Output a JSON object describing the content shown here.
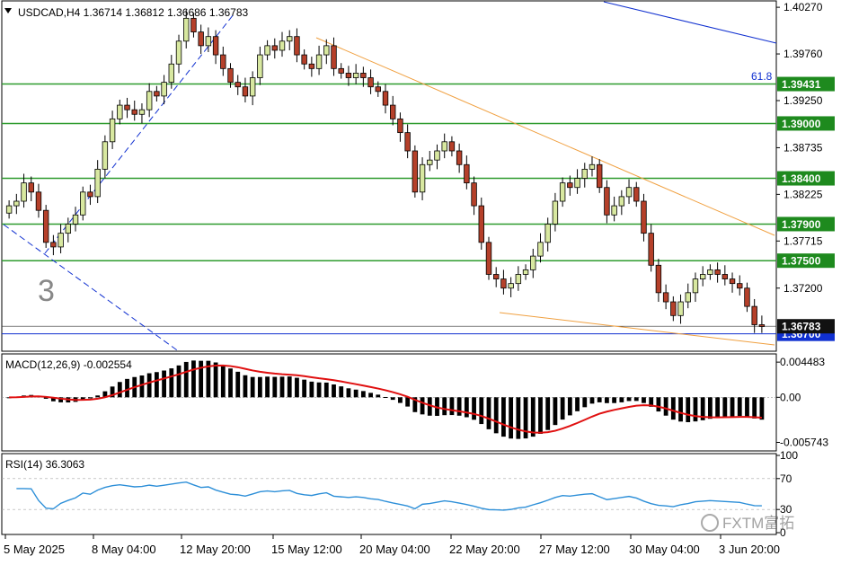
{
  "header": {
    "symbol_line": "USDCAD,H4  1.36714  1.36812  1.36686  1.36783"
  },
  "wave_label": "3",
  "fib_label": "61.8",
  "watermark": "FXTM富拓",
  "current_price_label": "1.36783",
  "blue_line_label": "1.36700",
  "colors": {
    "bull_candle": "#d8e8a0",
    "bear_candle": "#b5402a",
    "support_line": "#2e9b2e",
    "support_label_bg": "#1e8a1e",
    "blue_line": "#1030d0",
    "orange_line": "#f0a040",
    "macd_hist": "#000000",
    "macd_signal": "#e01010",
    "rsi_line": "#2d8fd8"
  },
  "chart_data": [
    {
      "type": "candlestick",
      "title": "USDCAD,H4",
      "ohlc_header": {
        "open": 1.36714,
        "high": 1.36812,
        "low": 1.36686,
        "close": 1.36783
      },
      "y_axis_ticks": [
        "1.40270",
        "1.39760",
        "1.39250",
        "1.38735",
        "1.38225",
        "1.37715",
        "1.37200"
      ],
      "y_range": [
        1.3652,
        1.4033
      ],
      "x_axis_ticks": [
        "5 May 2025",
        "8 May 04:00",
        "12 May 20:00",
        "15 May 12:00",
        "20 May 04:00",
        "22 May 20:00",
        "27 May 12:00",
        "30 May 04:00",
        "3 Jun 20:00"
      ],
      "horizontal_levels": [
        {
          "value": 1.39431,
          "label": "1.39431",
          "color": "green"
        },
        {
          "value": 1.39,
          "label": "1.39000",
          "color": "green"
        },
        {
          "value": 1.384,
          "label": "1.38400",
          "color": "green"
        },
        {
          "value": 1.379,
          "label": "1.37900",
          "color": "green"
        },
        {
          "value": 1.375,
          "label": "1.37500",
          "color": "green"
        },
        {
          "value": 1.367,
          "label": "1.36700",
          "color": "blue"
        }
      ],
      "current_price": 1.36783,
      "closes": [
        1.381,
        1.3815,
        1.3835,
        1.3825,
        1.3805,
        1.377,
        1.3765,
        1.378,
        1.379,
        1.38,
        1.3825,
        1.382,
        1.385,
        1.388,
        1.3905,
        1.392,
        1.3915,
        1.391,
        1.3915,
        1.3935,
        1.393,
        1.3945,
        1.3965,
        1.399,
        1.4015,
        1.4,
        1.3985,
        1.3995,
        1.3975,
        1.396,
        1.3945,
        1.394,
        1.393,
        1.395,
        1.3975,
        1.3985,
        1.398,
        1.399,
        1.3995,
        1.3975,
        1.3965,
        1.396,
        1.3975,
        1.3985,
        1.396,
        1.3955,
        1.395,
        1.3955,
        1.395,
        1.394,
        1.3935,
        1.392,
        1.3905,
        1.389,
        1.387,
        1.3825,
        1.3855,
        1.386,
        1.387,
        1.388,
        1.387,
        1.3855,
        1.3835,
        1.381,
        1.377,
        1.3735,
        1.373,
        1.372,
        1.3725,
        1.3735,
        1.374,
        1.3755,
        1.377,
        1.379,
        1.3815,
        1.3835,
        1.383,
        1.384,
        1.385,
        1.3855,
        1.383,
        1.38,
        1.381,
        1.382,
        1.383,
        1.3815,
        1.378,
        1.3745,
        1.3715,
        1.3705,
        1.369,
        1.3705,
        1.3715,
        1.373,
        1.3735,
        1.374,
        1.3735,
        1.373,
        1.3725,
        1.372,
        1.37,
        1.368,
        1.3678
      ],
      "series": [
        {
          "name": "MACD(12,26,9)",
          "indicator": "macd",
          "value": -0.002554,
          "y_axis_ticks": [
            "0.004483",
            "0.00",
            "-0.005743"
          ],
          "y_range": [
            -0.0066,
            0.0053
          ]
        },
        {
          "name": "RSI(14)",
          "indicator": "rsi",
          "value": 36.3063,
          "y_axis_ticks": [
            "100",
            "70",
            "30",
            "0"
          ],
          "y_range": [
            0,
            100
          ]
        }
      ],
      "grid": false
    }
  ]
}
